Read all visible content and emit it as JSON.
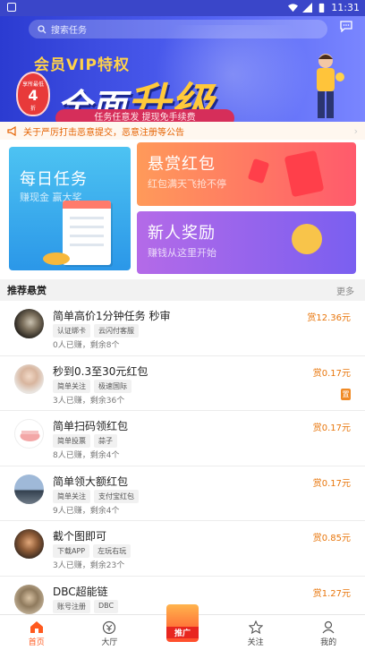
{
  "status": {
    "time": "11:31"
  },
  "search": {
    "placeholder": "搜索任务"
  },
  "banner": {
    "vip_text": "会员VIP特权",
    "title_a": "全面",
    "title_b": "升级",
    "badge_top": "享所最低",
    "badge_num": "4",
    "badge_bottom": "折",
    "subtitle": "任务任意发  提现免手续费"
  },
  "notice": {
    "text": "关于严厉打击恶意提交，恶意注册等公告"
  },
  "cards": [
    {
      "title": "每日任务",
      "subtitle": "赚现金  赢大奖"
    },
    {
      "title": "悬赏红包",
      "subtitle": "红包满天飞抢不停"
    },
    {
      "title": "新人奖励",
      "subtitle": "赚钱从这里开始"
    }
  ],
  "section": {
    "title": "推荐悬赏",
    "more": "更多"
  },
  "tasks": [
    {
      "title": "简单高价1分钟任务 秒审",
      "tags": [
        "认证绑卡",
        "云闪付客服"
      ],
      "joined": "0人已赚",
      "remain": "剩余8个",
      "price": "赏12.36元"
    },
    {
      "title": "秒到0.3至30元红包",
      "tags": [
        "简单关注",
        "极速国际"
      ],
      "joined": "3人已赚",
      "remain": "剩余36个",
      "price": "赏0.17元",
      "badge": "置"
    },
    {
      "title": "简单扫码领红包",
      "tags": [
        "简单投票",
        "蒜子"
      ],
      "joined": "8人已赚",
      "remain": "剩余4个",
      "price": "赏0.17元"
    },
    {
      "title": "简单领大额红包",
      "tags": [
        "简单关注",
        "支付宝红包"
      ],
      "joined": "9人已赚",
      "remain": "剩余4个",
      "price": "赏0.17元"
    },
    {
      "title": "截个图即可",
      "tags": [
        "下载APP",
        "左玩右玩"
      ],
      "joined": "3人已赚",
      "remain": "剩余23个",
      "price": "赏0.85元"
    },
    {
      "title": "DBC超能链",
      "tags": [
        "账号注册",
        "DBC"
      ],
      "joined": "",
      "remain": "",
      "price": "赏1.27元"
    }
  ],
  "tabs": [
    {
      "label": "首页",
      "icon": "home-icon"
    },
    {
      "label": "大厅",
      "icon": "hall-icon"
    },
    {
      "label": "推广",
      "icon": "promo-icon"
    },
    {
      "label": "关注",
      "icon": "star-icon"
    },
    {
      "label": "我的",
      "icon": "user-icon"
    }
  ],
  "colors": {
    "accent": "#ff5a1f",
    "price": "#e8750a",
    "banner": "#3a46c9"
  }
}
